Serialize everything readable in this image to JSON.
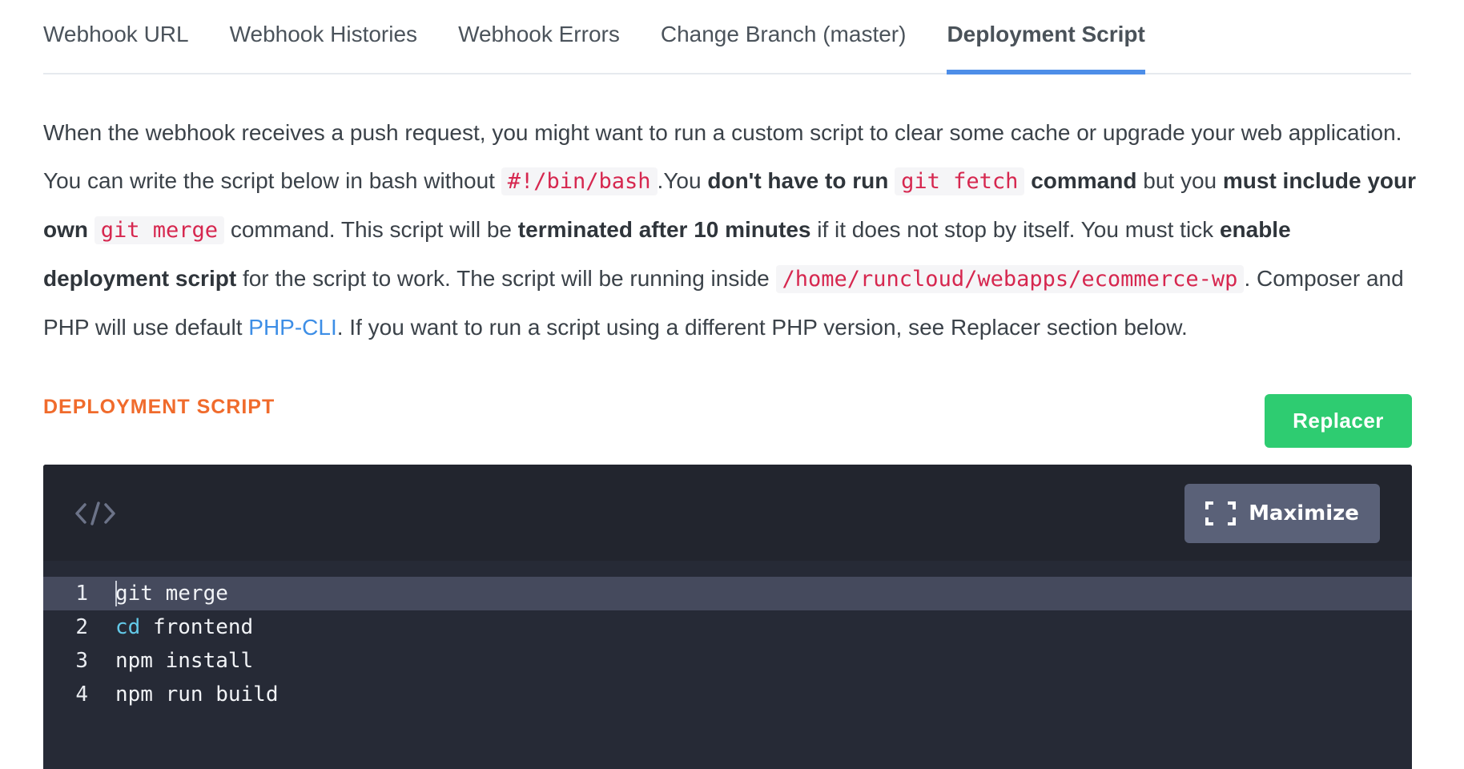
{
  "tabs": [
    {
      "label": "Webhook URL",
      "active": false
    },
    {
      "label": "Webhook Histories",
      "active": false
    },
    {
      "label": "Webhook Errors",
      "active": false
    },
    {
      "label": "Change Branch (master)",
      "active": false
    },
    {
      "label": "Deployment Script",
      "active": true
    }
  ],
  "description": {
    "t1": "When the webhook receives a push request, you might want to run a custom script to clear some cache or upgrade your web application. You can write the script below in bash without ",
    "code_shebang": "#!/bin/bash",
    "t2": ".You ",
    "b1": "don't have to run ",
    "code_fetch": "git fetch",
    "b2": " command",
    "t3": " but you ",
    "b3": "must include your own ",
    "code_merge": "git merge",
    "t4": " command. This script will be ",
    "b4": "terminated after 10 minutes",
    "t5": " if it does not stop by itself. You must tick ",
    "b5": "enable deployment script",
    "t6": " for the script to work. The script will be running inside ",
    "code_path": "/home/runcloud/webapps/ecommerce-wp",
    "t7": ". Composer and PHP will use default ",
    "link_phpcli": "PHP-CLI",
    "t8": ". If you want to run a script using a different PHP version, see Replacer section below."
  },
  "section": {
    "title": "DEPLOYMENT SCRIPT",
    "replacer_label": "Replacer"
  },
  "editor": {
    "maximize_label": "Maximize",
    "code_icon": "code-icon",
    "maximize_icon": "maximize-icon",
    "lines": [
      {
        "num": "1",
        "keyword": "",
        "text": "git merge"
      },
      {
        "num": "2",
        "keyword": "cd",
        "text": " frontend"
      },
      {
        "num": "3",
        "keyword": "",
        "text": "npm install"
      },
      {
        "num": "4",
        "keyword": "",
        "text": "npm run build"
      }
    ],
    "active_line": 1
  },
  "colors": {
    "tab_underline": "#4d8ee8",
    "section_title": "#f06b2c",
    "replacer_button": "#2ecc71",
    "editor_bg": "#262a36",
    "keyword": "#63c9e8",
    "inline_code": "#d6274f",
    "link": "#3d8ee6"
  }
}
